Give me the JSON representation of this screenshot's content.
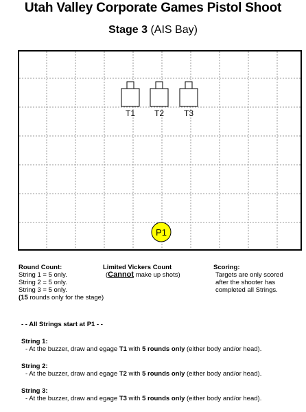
{
  "header": {
    "title": "Utah Valley Corporate Games Pistol Shoot",
    "stage_label": "Stage 3",
    "stage_sub": "(AIS Bay)"
  },
  "diagram": {
    "targets": [
      "T1",
      "T2",
      "T3"
    ],
    "position": "P1",
    "colors": {
      "position_fill": "#ffff00",
      "grid_line": "#9a9a9a"
    }
  },
  "round_count": {
    "heading": "Round Count:",
    "lines": [
      "String 1 = 5 only.",
      "String 2 = 5 only.",
      "String 3 = 5 only."
    ],
    "total_bold": "(15",
    "total_rest": " rounds only for the stage)"
  },
  "vickers": {
    "heading": "Limited Vickers Count",
    "pre": "(",
    "emph": "Cannot",
    "post": " make up shots)"
  },
  "scoring": {
    "heading": "Scoring:",
    "lines": [
      "Targets are only scored",
      "after the shooter has",
      "completed all Strings."
    ]
  },
  "instructions": {
    "start_note": "- - All Strings start at P1 - -",
    "strings": [
      {
        "label": "String 1:",
        "pre": "- At the buzzer, draw and egage ",
        "target": "T1",
        "mid": " with ",
        "rounds": "5 rounds only",
        "post": " (either body and/or head)."
      },
      {
        "label": "String 2:",
        "pre": "- At the buzzer, draw and egage ",
        "target": "T2",
        "mid": " with ",
        "rounds": "5 rounds only",
        "post": " (either body and/or head)."
      },
      {
        "label": "String 3:",
        "pre": "- At the buzzer, draw and egage ",
        "target": "T3",
        "mid": " with ",
        "rounds": "5 rounds only",
        "post": " (either body and/or head)."
      }
    ]
  }
}
